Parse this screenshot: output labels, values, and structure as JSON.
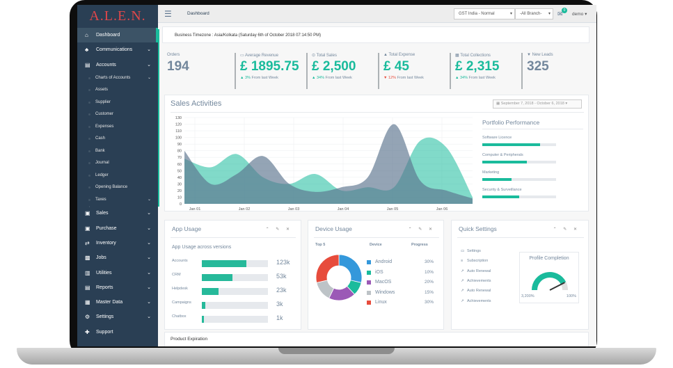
{
  "app": {
    "logo": "A.L.E.N."
  },
  "sidebar": {
    "items": [
      {
        "label": "Dashboard",
        "icon": "home-icon",
        "glyph": "⌂",
        "chevron": ""
      },
      {
        "label": "Communications",
        "icon": "bell-icon",
        "glyph": "♣",
        "chevron": "⌄"
      },
      {
        "label": "Accounts",
        "icon": "calculator-icon",
        "glyph": "▤",
        "chevron": "⌄"
      }
    ],
    "sub_items": [
      "Charts of Accounts",
      "Assets",
      "Supplier",
      "Customer",
      "Expenses",
      "Cash",
      "Bank",
      "Journal",
      "Ledger",
      "Opening Balance",
      "Taxes"
    ],
    "more_items": [
      {
        "label": "Sales",
        "icon": "money-icon",
        "glyph": "▣"
      },
      {
        "label": "Purchase",
        "icon": "cart-icon",
        "glyph": "▣"
      },
      {
        "label": "Inventory",
        "icon": "exchange-icon",
        "glyph": "⇄"
      },
      {
        "label": "Jobs",
        "icon": "briefcase-icon",
        "glyph": "▩"
      },
      {
        "label": "Utilities",
        "icon": "tools-icon",
        "glyph": "▥"
      },
      {
        "label": "Reports",
        "icon": "report-icon",
        "glyph": "▤"
      },
      {
        "label": "Master Data",
        "icon": "database-icon",
        "glyph": "▦"
      },
      {
        "label": "Settings",
        "icon": "gears-icon",
        "glyph": "⚙"
      },
      {
        "label": "Support",
        "icon": "support-icon",
        "glyph": "✚"
      }
    ]
  },
  "topbar": {
    "menu_icon": "☰",
    "breadcrumb": "Dashboard",
    "tax_select": "GST India - Normal",
    "branch_select": "-All Branch-",
    "mail_count": "0",
    "user": "demo"
  },
  "business_timezone": "Business Timezone : Asia/Kolkata (Saturday 6th of October 2018 07:14:50 PM)",
  "stats": [
    {
      "label": "Orders",
      "icon": "",
      "value": "194",
      "green": false,
      "trend": "",
      "change": "",
      "note": ""
    },
    {
      "label": "Average Revenue",
      "icon": "▭",
      "value": "£ 1895.75",
      "green": true,
      "trend": "▲",
      "change": "3%",
      "note": " From last Week",
      "dir": "up"
    },
    {
      "label": "Total Sales",
      "icon": "⊙",
      "value": "£ 2,500",
      "green": true,
      "trend": "▲",
      "change": "34%",
      "note": " From last Week",
      "dir": "up"
    },
    {
      "label": "Total Expense",
      "icon": "▲",
      "value": "£ 45",
      "green": true,
      "trend": "▼",
      "change": "12%",
      "note": " From last Week",
      "dir": "dn"
    },
    {
      "label": "Total Collections",
      "icon": "▦",
      "value": "£ 2,315",
      "green": true,
      "trend": "▲",
      "change": "34%",
      "note": " From last Week",
      "dir": "up"
    },
    {
      "label": "New Leads",
      "icon": "▼",
      "value": "325",
      "green": false,
      "trend": "",
      "change": "",
      "note": ""
    }
  ],
  "sales": {
    "title": "Sales Activities",
    "date_range": "September 7, 2018 - October 6, 2018",
    "calendar_icon": "▦",
    "portfolio_title": "Portfolio Performance",
    "portfolio": [
      {
        "label": "Software Licence",
        "value": 0.78
      },
      {
        "label": "Computer & Peripherals",
        "value": 0.6
      },
      {
        "label": "Marketing",
        "value": 0.4
      },
      {
        "label": "Security & Surveillance",
        "value": 0.5
      }
    ]
  },
  "chart_data": {
    "type": "area",
    "x": [
      "Jan 01",
      "Jan 02",
      "Jan 03",
      "Jan 04",
      "Jan 05",
      "Jan 06"
    ],
    "yticks": [
      0,
      10,
      20,
      30,
      40,
      50,
      60,
      70,
      80,
      90,
      100,
      110,
      120,
      130
    ],
    "ylim": [
      0,
      130
    ],
    "series": [
      {
        "color": "#1abb9c",
        "values": [
          68,
          55,
          75,
          40,
          30,
          45,
          20,
          25,
          25,
          95,
          85,
          10
        ]
      },
      {
        "color": "#5a738e",
        "values": [
          80,
          30,
          45,
          72,
          30,
          18,
          25,
          40,
          120,
          35,
          20,
          8
        ]
      }
    ]
  },
  "app_usage": {
    "title": "App Usage",
    "subtitle": "App Usage across versions",
    "rows": [
      {
        "name": "Accounts",
        "value": "123k",
        "fraction": 0.67
      },
      {
        "name": "CRM",
        "value": "53k",
        "fraction": 0.46
      },
      {
        "name": "Helpdesk",
        "value": "23k",
        "fraction": 0.25
      },
      {
        "name": "Campaigns",
        "value": "3k",
        "fraction": 0.05
      },
      {
        "name": "Chatbox",
        "value": "1k",
        "fraction": 0.03
      }
    ]
  },
  "device_usage": {
    "title": "Device Usage",
    "col_top": "Top 5",
    "col_device": "Device",
    "col_progress": "Progress",
    "devices": [
      {
        "name": "Android",
        "pct": "30%",
        "value": 30,
        "color": "#3498db"
      },
      {
        "name": "iOS",
        "pct": "10%",
        "value": 10,
        "color": "#1abb9c"
      },
      {
        "name": "MacOS",
        "pct": "20%",
        "value": 20,
        "color": "#9b59b6"
      },
      {
        "name": "Windows",
        "pct": "15%",
        "value": 15,
        "color": "#bdc3c7"
      },
      {
        "name": "Linux",
        "pct": "30%",
        "value": 30,
        "color": "#e74c3c"
      }
    ]
  },
  "quick_settings": {
    "title": "Quick Settings",
    "items": [
      {
        "label": "Settings",
        "icon": "calendar-icon",
        "glyph": "▭"
      },
      {
        "label": "Subscription",
        "icon": "bars-icon",
        "glyph": "≡"
      },
      {
        "label": "Auto Renewal",
        "icon": "chart-icon",
        "glyph": "↗"
      },
      {
        "label": "Achievements",
        "icon": "chart-icon",
        "glyph": "↗"
      },
      {
        "label": "Auto Renewal",
        "icon": "chart-icon",
        "glyph": "↗"
      },
      {
        "label": "Achievements",
        "icon": "chart-icon",
        "glyph": "↗"
      }
    ],
    "profile_title": "Profile Completion",
    "gauge_min": "3,200%",
    "gauge_max": "100%",
    "gauge_level": 0.85
  },
  "card_controls": "⌃ ✎ ✕",
  "product_expiration": "Product Expiration"
}
